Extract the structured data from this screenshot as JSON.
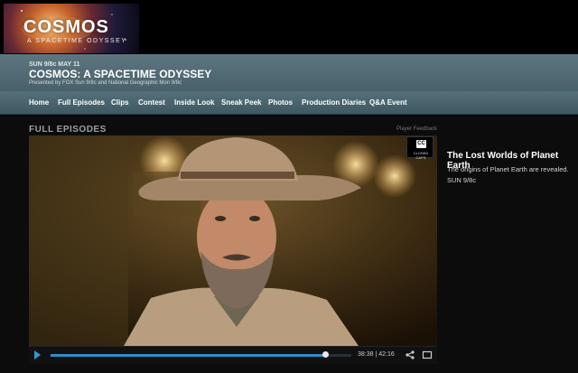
{
  "logo": {
    "title": "COSMOS",
    "subtitle": "A SPACETIME ODYSSEY"
  },
  "show": {
    "air_time": "SUN 9/8c MAY 11",
    "title": "COSMOS: A SPACETIME ODYSSEY",
    "presented_by": "Presented by FOX Sun 9/8c and National Geographic Mon 9/8c"
  },
  "nav": {
    "items": [
      {
        "label": "Home"
      },
      {
        "label": "Full Episodes"
      },
      {
        "label": "Clips"
      },
      {
        "label": "Contest"
      },
      {
        "label": "Inside Look"
      },
      {
        "label": "Sneak Peek"
      },
      {
        "label": "Photos"
      },
      {
        "label": "Production Diaries"
      },
      {
        "label": "Q&A Event"
      }
    ]
  },
  "section": {
    "label": "FULL EPISODES",
    "feedback": "Player Feedback"
  },
  "player": {
    "cc_glyph": "CC",
    "cc_label": "CLOSED CAPS",
    "elapsed": "38:38",
    "duration": "42:16",
    "time_separator": "|",
    "progress_fraction": 0.914,
    "accent": "#2d8ec9"
  },
  "episode": {
    "title": "The Lost Worlds of Planet Earth",
    "description": "The origins of Planet Earth are revealed. SUN 9/8c"
  }
}
